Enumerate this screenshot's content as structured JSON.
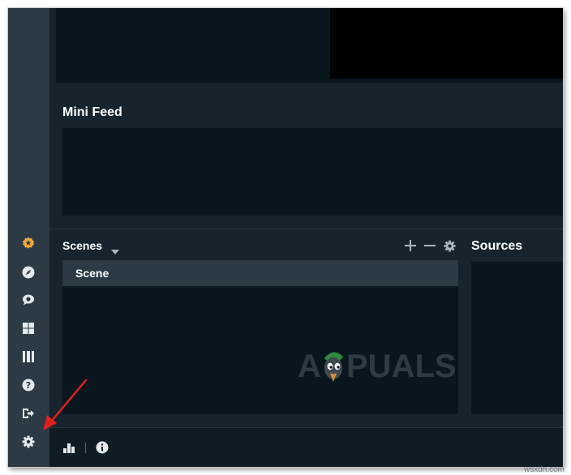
{
  "sidebar": {
    "items": [
      {
        "icon": "star-badge-icon"
      },
      {
        "icon": "compass-icon"
      },
      {
        "icon": "chat-bubble-icon"
      },
      {
        "icon": "layout-grid-icon"
      },
      {
        "icon": "columns-icon"
      },
      {
        "icon": "help-icon"
      },
      {
        "icon": "logout-icon"
      },
      {
        "icon": "settings-gear-icon"
      }
    ]
  },
  "minifeed": {
    "title": "Mini Feed"
  },
  "scenes": {
    "title": "Scenes",
    "items": [
      "Scene"
    ],
    "tools": [
      "add-icon",
      "remove-icon",
      "gear-icon"
    ]
  },
  "sources": {
    "title": "Sources"
  },
  "footer": {
    "icons": [
      "stats-bar-chart-icon",
      "info-icon"
    ]
  },
  "watermark": {
    "text": "A PUALS"
  },
  "credit": {
    "text": "wsxdn.com"
  },
  "colors": {
    "accent_orange": "#f0a53a",
    "annotation_arrow": "#e02020",
    "panel_bg": "#09161d",
    "main_bg": "#17242d",
    "sidebar_bg": "#2b3a44"
  }
}
